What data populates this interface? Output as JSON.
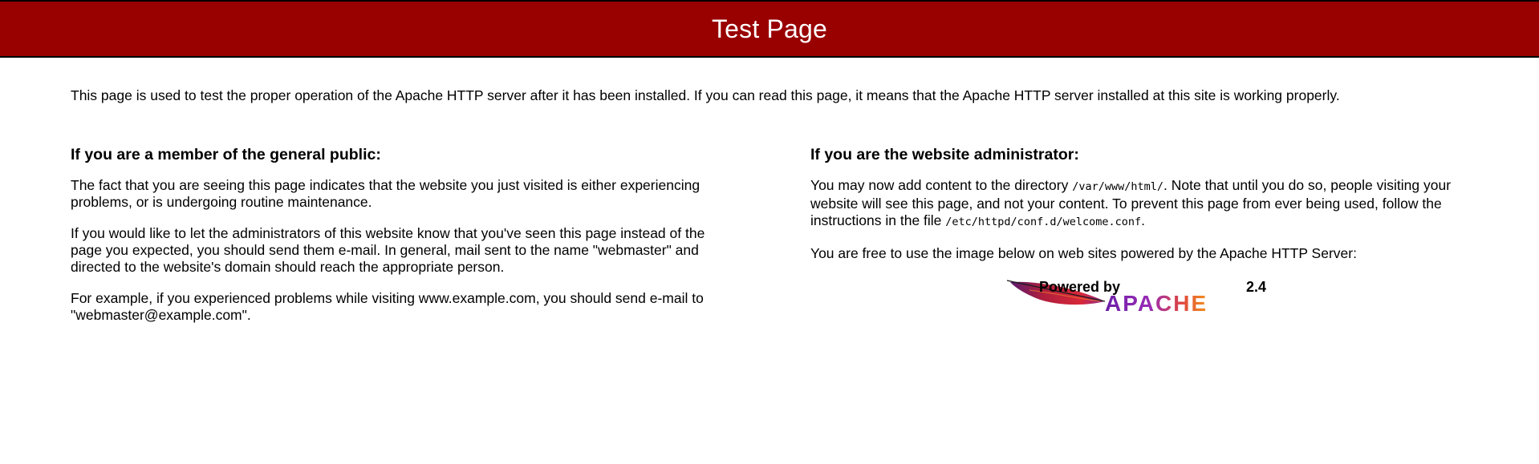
{
  "colors": {
    "banner_background": "#990000",
    "banner_text": "#ffffff",
    "body_text": "#000000"
  },
  "header": {
    "title": "Test Page"
  },
  "intro": "This page is used to test the proper operation of the Apache HTTP server after it has been installed. If you can read this page, it means that the Apache HTTP server installed at this site is working properly.",
  "public_section": {
    "heading": "If you are a member of the general public:",
    "paragraphs": [
      "The fact that you are seeing this page indicates that the website you just visited is either experiencing problems, or is undergoing routine maintenance.",
      "If you would like to let the administrators of this website know that you've seen this page instead of the page you expected, you should send them e-mail. In general, mail sent to the name \"webmaster\" and directed to the website's domain should reach the appropriate person.",
      "For example, if you experienced problems while visiting www.example.com, you should send e-mail to \"webmaster@example.com\"."
    ]
  },
  "admin_section": {
    "heading": "If you are the website administrator:",
    "p1_before": "You may now add content to the directory ",
    "p1_dir": "/var/www/html/",
    "p1_middle": ". Note that until you do so, people visiting your website will see this page, and not your content. To prevent this page from ever being used, follow the instructions in the file ",
    "p1_file": "/etc/httpd/conf.d/welcome.conf",
    "p1_after": ".",
    "p2": "You are free to use the image below on web sites powered by the Apache HTTP Server:"
  },
  "logo": {
    "icon": "apache-feather-icon",
    "powered_by": "Powered by",
    "version": "2.4",
    "brand": "APACHE"
  }
}
